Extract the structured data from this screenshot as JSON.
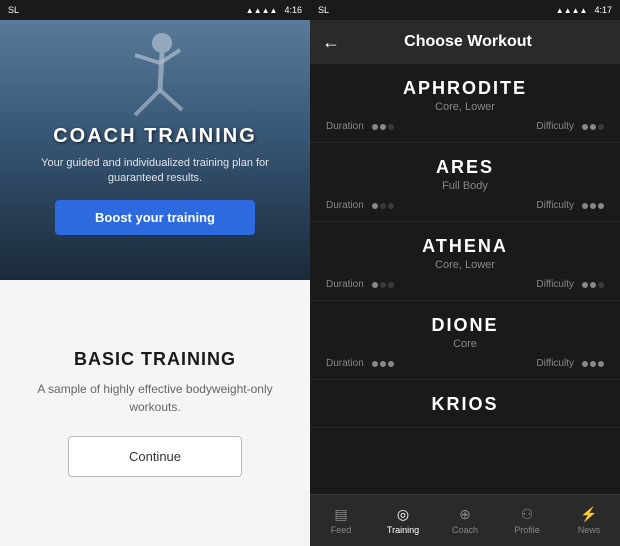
{
  "left": {
    "status_bar": {
      "carrier": "SL",
      "time": "4:16"
    },
    "hero": {
      "title": "COACH TRAINING",
      "subtitle": "Your guided and individualized training plan for guaranteed results.",
      "boost_button": "Boost your training"
    },
    "basic": {
      "title": "BASIC TRAINING",
      "subtitle": "A sample of highly effective bodyweight-only workouts.",
      "continue_button": "Continue"
    }
  },
  "right": {
    "status_bar": {
      "carrier": "SL",
      "time": "4:17"
    },
    "header": {
      "title": "Choose Workout",
      "back_label": "←"
    },
    "workouts": [
      {
        "name": "APHRODITE",
        "category": "Core, Lower",
        "duration_dots": [
          true,
          true,
          false
        ],
        "difficulty_dots": [
          true,
          true,
          false
        ]
      },
      {
        "name": "ARES",
        "category": "Full Body",
        "duration_dots": [
          true,
          false,
          false
        ],
        "difficulty_dots": [
          true,
          true,
          true
        ]
      },
      {
        "name": "ATHENA",
        "category": "Core, Lower",
        "duration_dots": [
          true,
          false,
          false
        ],
        "difficulty_dots": [
          true,
          true,
          false
        ]
      },
      {
        "name": "DIONE",
        "category": "Core",
        "duration_dots": [
          true,
          true,
          true
        ],
        "difficulty_dots": [
          true,
          true,
          true
        ]
      },
      {
        "name": "KRIOS",
        "category": "",
        "duration_dots": [],
        "difficulty_dots": []
      }
    ],
    "nav": {
      "items": [
        {
          "icon": "💬",
          "label": "Feed",
          "active": false
        },
        {
          "icon": "⚡",
          "label": "Training",
          "active": true
        },
        {
          "icon": "🅒",
          "label": "Coach",
          "active": false
        },
        {
          "icon": "👤",
          "label": "Profile",
          "active": false
        },
        {
          "icon": "⚡",
          "label": "News",
          "active": false
        }
      ]
    }
  }
}
